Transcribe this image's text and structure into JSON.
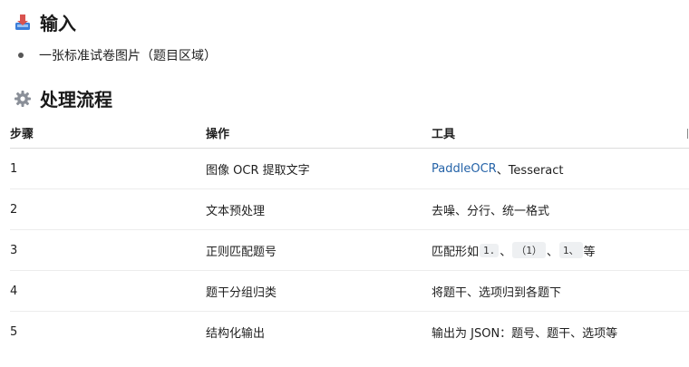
{
  "sections": {
    "input": {
      "title": "输入",
      "icon": "inbox-tray-icon",
      "bullets": [
        "一张标准试卷图片（题目区域）"
      ]
    },
    "process": {
      "title": "处理流程",
      "icon": "gear-icon"
    }
  },
  "table": {
    "headers": [
      "步骤",
      "操作",
      "工具"
    ],
    "rows": [
      {
        "step": "1",
        "action": "图像 OCR 提取文字",
        "tool_link": "PaddleOCR",
        "tool_rest": "、Tesseract"
      },
      {
        "step": "2",
        "action": "文本预处理",
        "tool": "去噪、分行、统一格式"
      },
      {
        "step": "3",
        "action": "正则匹配题号",
        "tool_prefix": "匹配形如",
        "codes": [
          "1.",
          "（1）",
          "1、"
        ],
        "sep1": "、",
        "sep2": "、",
        "tool_suffix": "等"
      },
      {
        "step": "4",
        "action": "题干分组归类",
        "tool": "将题干、选项归到各题下"
      },
      {
        "step": "5",
        "action": "结构化输出",
        "tool": "输出为 JSON：题号、题干、选项等"
      }
    ]
  },
  "colors": {
    "link": "#2563a8",
    "code_bg": "#eef0f2"
  }
}
